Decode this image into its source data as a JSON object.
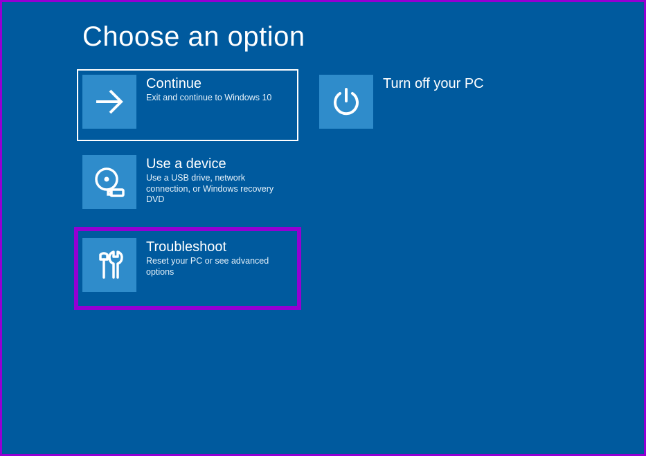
{
  "title": "Choose an option",
  "tiles": {
    "continue": {
      "title": "Continue",
      "desc": "Exit and continue to Windows 10"
    },
    "turnoff": {
      "title": "Turn off your PC",
      "desc": ""
    },
    "device": {
      "title": "Use a device",
      "desc": "Use a USB drive, network connection, or Windows recovery DVD"
    },
    "troubleshoot": {
      "title": "Troubleshoot",
      "desc": "Reset your PC or see advanced options"
    }
  }
}
